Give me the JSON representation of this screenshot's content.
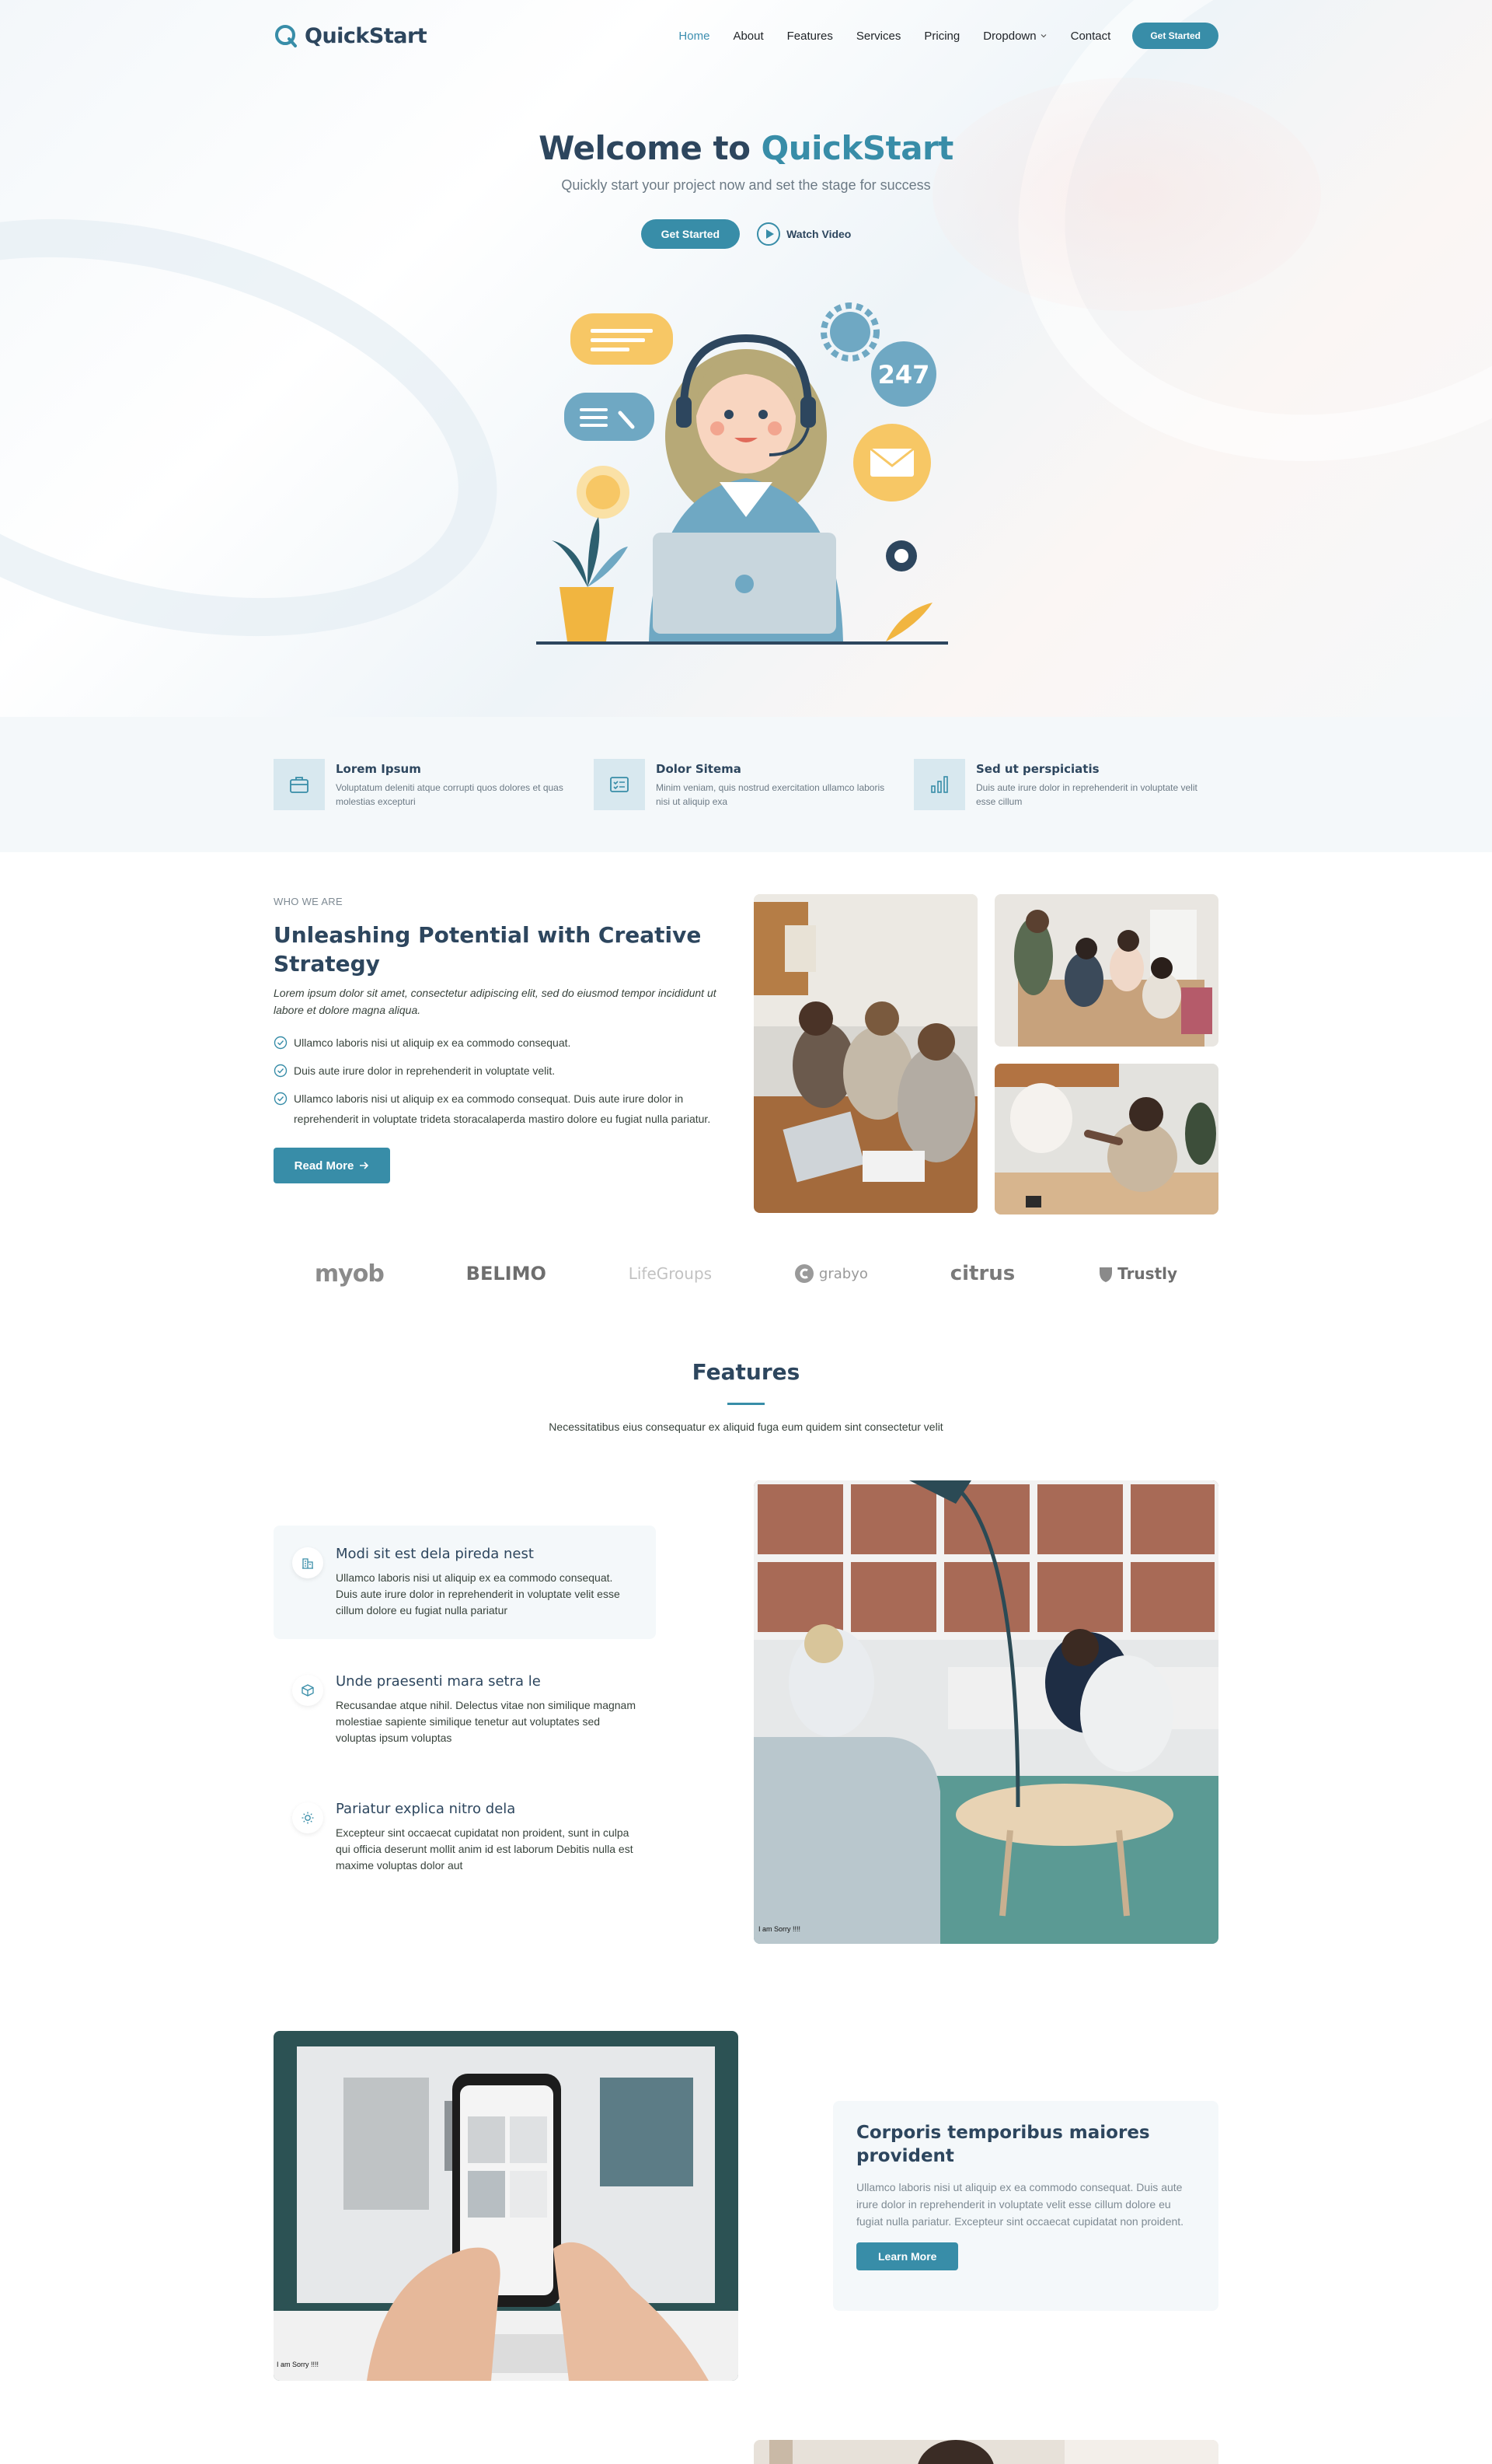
{
  "brand": {
    "name": "QuickStart",
    "accent": "#388da8",
    "dark": "#2d465e"
  },
  "nav": {
    "items": [
      "Home",
      "About",
      "Features",
      "Services",
      "Pricing",
      "Dropdown",
      "Contact"
    ],
    "active": "Home",
    "cta": "Get Started"
  },
  "hero": {
    "title_pre": "Welcome to",
    "title_accent": "QuickStart",
    "subtitle": "Quickly start your project now and set the stage for success",
    "btn_primary": "Get Started",
    "btn_video": "Watch Video",
    "badge_247": "247"
  },
  "strip": [
    {
      "title": "Lorem Ipsum",
      "text": "Voluptatum deleniti atque corrupti quos dolores et quas molestias excepturi",
      "icon": "briefcase-icon"
    },
    {
      "title": "Dolor Sitema",
      "text": "Minim veniam, quis nostrud exercitation ullamco laboris nisi ut aliquip exa",
      "icon": "card-checklist-icon"
    },
    {
      "title": "Sed ut perspiciatis",
      "text": "Duis aute irure dolor in reprehenderit in voluptate velit esse cillum",
      "icon": "bar-chart-icon"
    }
  ],
  "about": {
    "kicker": "WHO WE ARE",
    "title": "Unleashing Potential with Creative Strategy",
    "lead": "Lorem ipsum dolor sit amet, consectetur adipiscing elit, sed do eiusmod tempor incididunt ut labore et dolore magna aliqua.",
    "list": [
      "Ullamco laboris nisi ut aliquip ex ea commodo consequat.",
      "Duis aute irure dolor in reprehenderit in voluptate velit.",
      "Ullamco laboris nisi ut aliquip ex ea commodo consequat. Duis aute irure dolor in reprehenderit in voluptate trideta storacalaperda mastiro dolore eu fugiat nulla pariatur."
    ],
    "button": "Read More"
  },
  "clients": [
    "myob",
    "BELIMO",
    "LifeGroups",
    "grabyo",
    "citrus",
    "Trustly"
  ],
  "features": {
    "title": "Features",
    "subtitle": "Necessitatibus eius consequatur ex aliquid fuga eum quidem sint consectetur velit",
    "items": [
      {
        "title": "Modi sit est dela pireda nest",
        "text": "Ullamco laboris nisi ut aliquip ex ea commodo consequat. Duis aute irure dolor in reprehenderit in voluptate velit esse cillum dolore eu fugiat nulla pariatur",
        "icon": "buildings-icon"
      },
      {
        "title": "Unde praesenti mara setra le",
        "text": "Recusandae atque nihil. Delectus vitae non similique magnam molestiae sapiente similique tenetur aut voluptates sed voluptas ipsum voluptas",
        "icon": "box-icon"
      },
      {
        "title": "Pariatur explica nitro dela",
        "text": "Excepteur sint occaecat cupidatat non proident, sunt in culpa qui officia deserunt mollit anim id est laborum Debitis nulla est maxime voluptas dolor aut",
        "icon": "sun-icon"
      }
    ],
    "image_caption": "I am Sorry !!!!"
  },
  "promo": {
    "title": "Corporis temporibus maiores provident",
    "text": "Ullamco laboris nisi ut aliquip ex ea commodo consequat. Duis aute irure dolor in reprehenderit in voluptate velit esse cillum dolore eu fugiat nulla pariatur. Excepteur sint occaecat cupidatat non proident.",
    "button": "Learn More",
    "image_caption": "I am Sorry !!!!"
  }
}
